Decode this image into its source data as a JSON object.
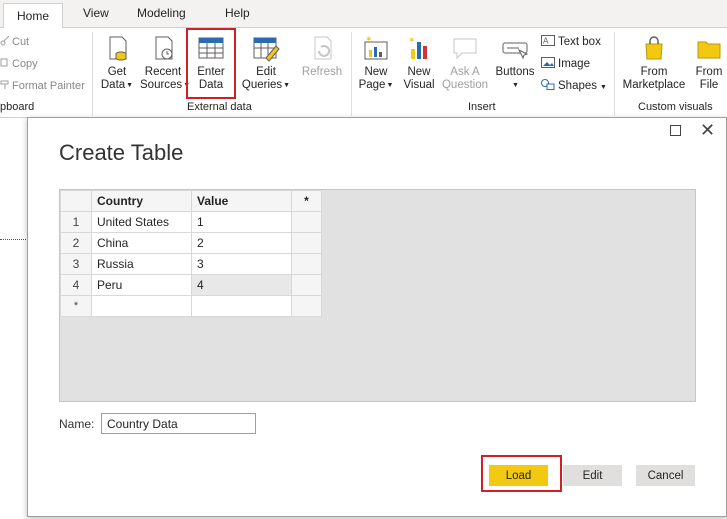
{
  "tabs": [
    {
      "label": "Home",
      "active": true
    },
    {
      "label": "View"
    },
    {
      "label": "Modeling"
    },
    {
      "label": "Help"
    }
  ],
  "clipboard": {
    "cut": "Cut",
    "copy": "Copy",
    "format_painter": "Format Painter",
    "group_label": "pboard"
  },
  "external_data": {
    "get_data": [
      "Get",
      "Data"
    ],
    "recent_sources": [
      "Recent",
      "Sources"
    ],
    "enter_data": [
      "Enter",
      "Data"
    ],
    "edit_queries": [
      "Edit",
      "Queries"
    ],
    "refresh": "Refresh",
    "group_label": "External data"
  },
  "insert": {
    "new_page": [
      "New",
      "Page"
    ],
    "new_visual": [
      "New",
      "Visual"
    ],
    "ask_question": [
      "Ask A",
      "Question"
    ],
    "buttons": "Buttons",
    "text_box": "Text box",
    "image": "Image",
    "shapes": "Shapes",
    "group_label": "Insert"
  },
  "custom_visuals": {
    "from_marketplace": [
      "From",
      "Marketplace"
    ],
    "from_file": [
      "From",
      "File"
    ],
    "group_label": "Custom visuals"
  },
  "dialog": {
    "title": "Create Table",
    "star": "*",
    "columns": [
      "Country",
      "Value"
    ],
    "rows": [
      {
        "num": "1",
        "country": "United States",
        "value": "1"
      },
      {
        "num": "2",
        "country": "China",
        "value": "2"
      },
      {
        "num": "3",
        "country": "Russia",
        "value": "3"
      },
      {
        "num": "4",
        "country": "Peru",
        "value": "4"
      }
    ],
    "name_label": "Name:",
    "name_value": "Country Data",
    "load": "Load",
    "edit": "Edit",
    "cancel": "Cancel"
  },
  "colors": {
    "load_button": "#f2c811",
    "highlight": "#d01f27"
  }
}
